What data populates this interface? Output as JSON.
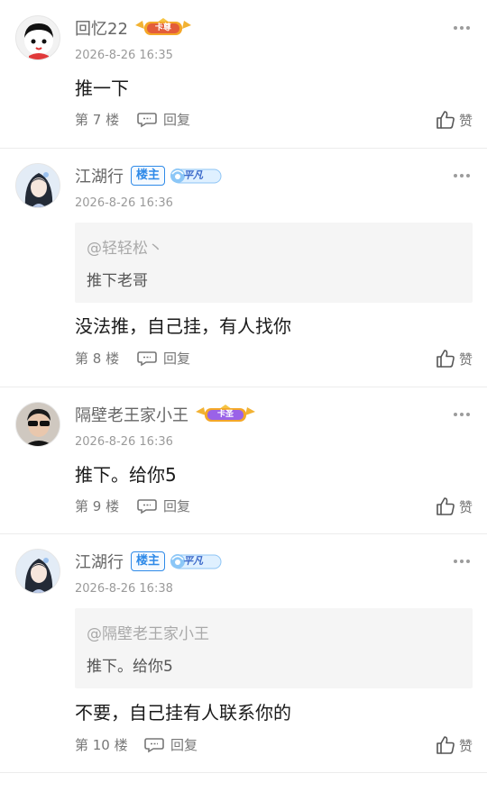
{
  "posts": [
    {
      "username": "回忆22",
      "badge_text": "卡尊",
      "timestamp": "2026-8-26 16:35",
      "content": "推一下",
      "floor": "第 7 楼",
      "reply_label": "回复",
      "like_label": "赞"
    },
    {
      "username": "江湖行",
      "owner_label": "楼主",
      "level_text": "平凡",
      "timestamp": "2026-8-26 16:36",
      "quote_user": "@轻轻松丶",
      "quote_text": "推下老哥",
      "content": "没法推，自己挂，有人找你",
      "floor": "第 8 楼",
      "reply_label": "回复",
      "like_label": "赞"
    },
    {
      "username": "隔壁老王家小王",
      "badge_text": "卡圣",
      "timestamp": "2026-8-26 16:36",
      "content": "推下。给你5",
      "floor": "第 9 楼",
      "reply_label": "回复",
      "like_label": "赞"
    },
    {
      "username": "江湖行",
      "owner_label": "楼主",
      "level_text": "平凡",
      "timestamp": "2026-8-26 16:38",
      "quote_user": "@隔壁老王家小王",
      "quote_text": "推下。给你5",
      "content": "不要，自己挂有人联系你的",
      "floor": "第 10 楼",
      "reply_label": "回复",
      "like_label": "赞"
    }
  ],
  "icons": {
    "more": "more-dots-icon",
    "reply": "comment-bubble-icon",
    "like": "thumbs-up-icon"
  },
  "colors": {
    "owner_badge": "#2f8ae8",
    "timestamp": "#9a9a9a",
    "quote_bg": "#f5f5f5"
  }
}
